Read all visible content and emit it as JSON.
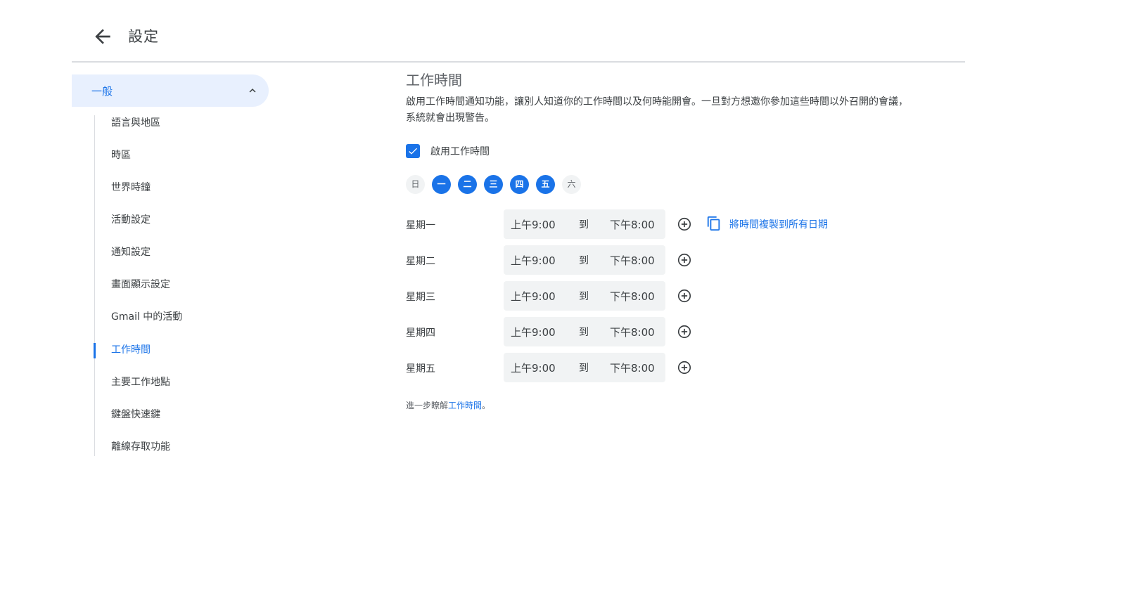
{
  "header": {
    "title": "設定"
  },
  "sidebar": {
    "section_label": "一般",
    "items": [
      {
        "label": "語言與地區",
        "active": false
      },
      {
        "label": "時區",
        "active": false
      },
      {
        "label": "世界時鐘",
        "active": false
      },
      {
        "label": "活動設定",
        "active": false
      },
      {
        "label": "通知設定",
        "active": false
      },
      {
        "label": "畫面顯示設定",
        "active": false
      },
      {
        "label": "Gmail 中的活動",
        "active": false
      },
      {
        "label": "工作時間",
        "active": true
      },
      {
        "label": "主要工作地點",
        "active": false
      },
      {
        "label": "鍵盤快速鍵",
        "active": false
      },
      {
        "label": "離線存取功能",
        "active": false
      }
    ]
  },
  "main": {
    "title": "工作時間",
    "description": "啟用工作時間通知功能，讓別人知道你的工作時間以及何時能開會。一旦對方想邀你參加這些時間以外召開的會議，系統就會出現警告。",
    "enable_label": "啟用工作時間",
    "enable_checked": true,
    "days": [
      {
        "label": "日",
        "selected": false
      },
      {
        "label": "一",
        "selected": true
      },
      {
        "label": "二",
        "selected": true
      },
      {
        "label": "三",
        "selected": true
      },
      {
        "label": "四",
        "selected": true
      },
      {
        "label": "五",
        "selected": true
      },
      {
        "label": "六",
        "selected": false
      }
    ],
    "schedule": [
      {
        "day": "星期一",
        "start": "上午9:00",
        "to": "到",
        "end": "下午8:00"
      },
      {
        "day": "星期二",
        "start": "上午9:00",
        "to": "到",
        "end": "下午8:00"
      },
      {
        "day": "星期三",
        "start": "上午9:00",
        "to": "到",
        "end": "下午8:00"
      },
      {
        "day": "星期四",
        "start": "上午9:00",
        "to": "到",
        "end": "下午8:00"
      },
      {
        "day": "星期五",
        "start": "上午9:00",
        "to": "到",
        "end": "下午8:00"
      }
    ],
    "copy_all_label": "將時間複製到所有日期",
    "learn_more_prefix": "進一步瞭解",
    "learn_more_link": "工作時間",
    "learn_more_suffix": "。"
  },
  "colors": {
    "accent": "#1a73e8",
    "section_bg": "#e8f0fe",
    "time_box_bg": "#f1f3f4"
  }
}
